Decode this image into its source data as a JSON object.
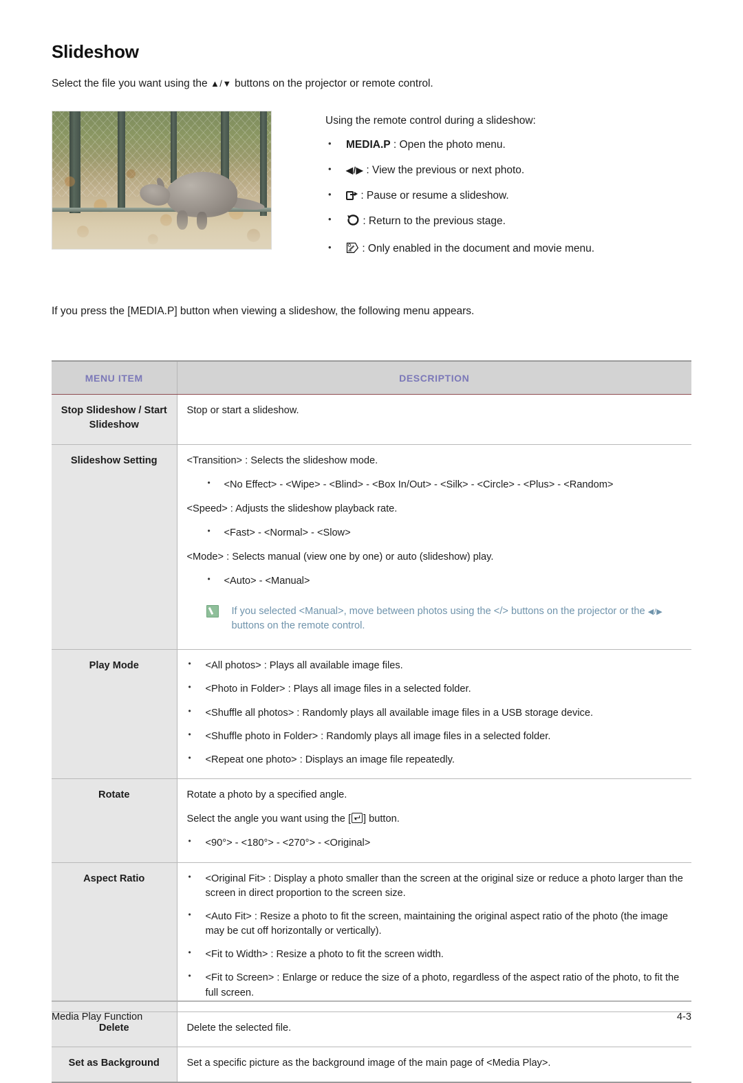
{
  "heading": "Slideshow",
  "intro": {
    "before": "Select the file you want using the",
    "keys": "▲/▼",
    "after": "buttons on the projector or remote control."
  },
  "photo": {
    "alt": "kangaroo-in-enclosure-photo"
  },
  "remote": {
    "title": "Using the remote control during a slideshow:",
    "items": [
      {
        "icon": "media-p-label",
        "key": "MEDIA.P",
        "text": ": Open the photo menu."
      },
      {
        "icon": "left-right-arrows",
        "key": "◀/▶",
        "text": ": View the previous or next photo."
      },
      {
        "icon": "box-arrow-icon",
        "key": "",
        "text": ": Pause or resume a slideshow."
      },
      {
        "icon": "return-arrow-icon",
        "key": "↺",
        "text": ": Return to the previous stage."
      },
      {
        "icon": "pen-tool-icon",
        "key": "",
        "text": ": Only enabled in the document and movie menu."
      }
    ]
  },
  "mid_paragraph": "If you press the [MEDIA.P] button when viewing a slideshow, the following menu appears.",
  "table": {
    "headers": {
      "menu_item": "MENU ITEM",
      "description": "DESCRIPTION"
    },
    "rows": [
      {
        "name": "Stop Slideshow / Start Slideshow",
        "paras": [
          "Stop or start a slideshow."
        ]
      },
      {
        "name": "Slideshow Setting",
        "t_transition": "<Transition> : Selects the slideshow mode.",
        "t_transition_opts": "<No Effect> - <Wipe> - <Blind> - <Box In/Out> - <Silk> - <Circle> - <Plus> - <Random>",
        "t_speed": "<Speed> : Adjusts the slideshow playback rate.",
        "t_speed_opts": "<Fast> - <Normal> - <Slow>",
        "t_mode": "<Mode> : Selects manual (view one by one) or auto (slideshow) play.",
        "t_mode_opts": "<Auto> - <Manual>",
        "note_a": "If you selected <Manual>, move between photos using the </> buttons on the projector or the",
        "note_keys": "◀/▶",
        "note_b": "buttons on the remote control."
      },
      {
        "name": "Play Mode",
        "bullets": [
          "<All photos> : Plays all available image files.",
          "<Photo in Folder> : Plays all image files in a selected folder.",
          "<Shuffle all photos> : Randomly plays all available image files in a USB storage device.",
          "<Shuffle photo in Folder> : Randomly plays all image files in a selected folder.",
          "<Repeat one photo> : Displays an image file repeatedly."
        ]
      },
      {
        "name": "Rotate",
        "p1": "Rotate a photo by a specified angle.",
        "p2_before": "Select the angle you want using the [",
        "p2_after": "] button.",
        "opts": "<90°> - <180°> - <270°> - <Original>"
      },
      {
        "name": "Aspect Ratio",
        "bullets": [
          "<Original Fit> : Display a photo smaller than the screen at the original size or reduce a photo larger than the screen in direct proportion to the screen size.",
          "<Auto Fit> : Resize a photo to fit the screen, maintaining the original aspect ratio of the photo (the image may be cut off horizontally or vertically).",
          "<Fit to Width> : Resize a photo to fit the screen width.",
          "<Fit to Screen> : Enlarge or reduce the size of a photo, regardless of the aspect ratio of the photo, to fit the full screen."
        ]
      },
      {
        "name": "Delete",
        "paras": [
          "Delete the selected file."
        ]
      },
      {
        "name": "Set as Background",
        "paras": [
          "Set a specific picture as the background image of the main page of <Media Play>."
        ]
      }
    ]
  },
  "footer": {
    "left": "Media Play Function",
    "right": "4-3"
  },
  "colors": {
    "header_text": "#7b78b8",
    "header_bg": "#d3d3d3",
    "key_cell_bg": "#e6e6e6",
    "note_text": "#6f93ab",
    "note_icon": "#8fbf9a",
    "header_underline": "#8d4a4f"
  }
}
